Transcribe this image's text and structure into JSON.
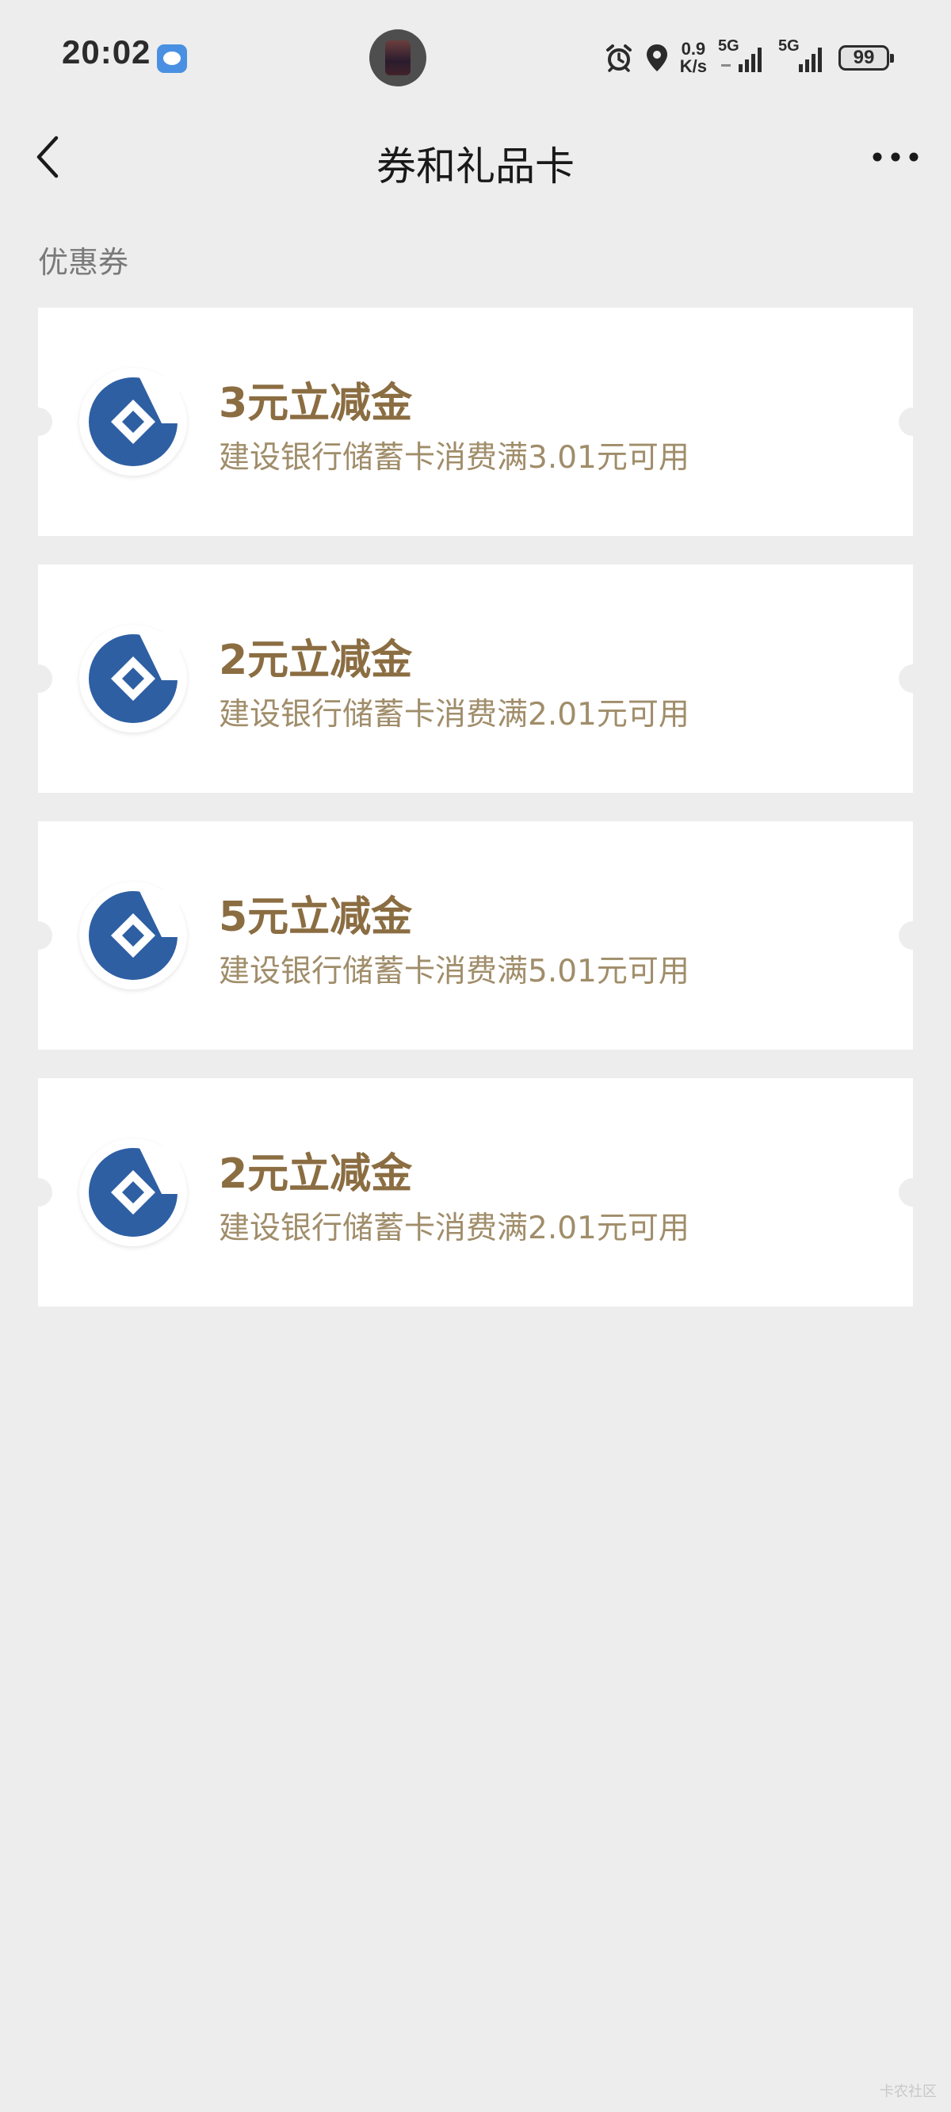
{
  "status_bar": {
    "time": "20:02",
    "net_speed_value": "0.9",
    "net_speed_unit": "K/s",
    "sim1_label": "5G",
    "sim2_label": "5G",
    "battery": "99"
  },
  "nav": {
    "title": "券和礼品卡"
  },
  "section": {
    "title": "优惠券"
  },
  "coupons": [
    {
      "title": "3元立减金",
      "desc": "建设银行储蓄卡消费满3.01元可用",
      "logo": "ccb-bank-icon"
    },
    {
      "title": "2元立减金",
      "desc": "建设银行储蓄卡消费满2.01元可用",
      "logo": "ccb-bank-icon"
    },
    {
      "title": "5元立减金",
      "desc": "建设银行储蓄卡消费满5.01元可用",
      "logo": "ccb-bank-icon"
    },
    {
      "title": "2元立减金",
      "desc": "建设银行储蓄卡消费满2.01元可用",
      "logo": "ccb-bank-icon"
    }
  ],
  "watermark": "卡农社区",
  "colors": {
    "background": "#ededed",
    "card": "#ffffff",
    "coupon_title": "#8b6d42",
    "coupon_desc": "#a08d6a",
    "bank_blue": "#2e5fa3"
  }
}
